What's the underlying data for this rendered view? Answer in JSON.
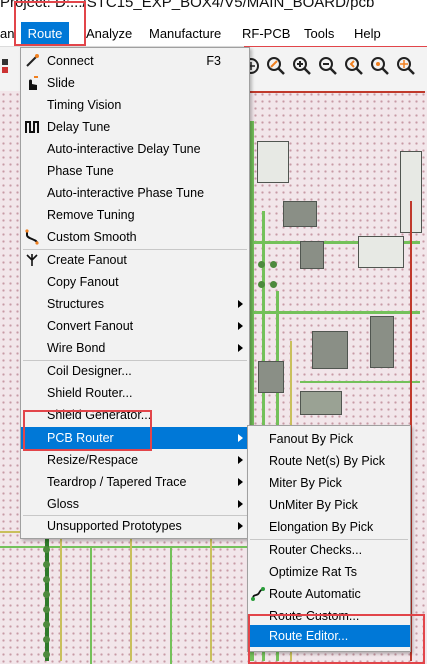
{
  "window": {
    "title": "Project: D:.../STC15_EXP_BOX4/V5/MAIN_BOARD/pcb"
  },
  "menubar": {
    "items": [
      "an",
      "Route",
      "Analyze",
      "Manufacture",
      "RF-PCB",
      "Tools",
      "Help"
    ]
  },
  "route_menu": {
    "items": [
      {
        "label": "Connect",
        "shortcut": "F3",
        "icon": "connect-icon"
      },
      {
        "label": "Slide",
        "icon": "slide-hand-icon"
      },
      {
        "label": "Timing Vision"
      },
      {
        "label": "Delay Tune",
        "icon": "delay-tune-icon"
      },
      {
        "label": "Auto-interactive Delay Tune"
      },
      {
        "label": "Phase Tune"
      },
      {
        "label": "Auto-interactive Phase Tune"
      },
      {
        "label": "Remove Tuning"
      },
      {
        "label": "Custom Smooth",
        "icon": "custom-smooth-icon"
      },
      {
        "label": "Create Fanout",
        "icon": "create-fanout-icon"
      },
      {
        "label": "Copy Fanout"
      },
      {
        "label": "Structures",
        "submenu": true
      },
      {
        "label": "Convert Fanout",
        "submenu": true
      },
      {
        "label": "Wire Bond",
        "submenu": true
      },
      {
        "label": "Coil Designer..."
      },
      {
        "label": "Shield Router..."
      },
      {
        "label": "Shield Generator..."
      },
      {
        "label": "PCB Router",
        "submenu": true,
        "selected": true
      },
      {
        "label": "Resize/Respace",
        "submenu": true
      },
      {
        "label": "Teardrop / Tapered Trace",
        "submenu": true
      },
      {
        "label": "Gloss",
        "submenu": true
      },
      {
        "label": "Unsupported Prototypes",
        "submenu": true
      }
    ]
  },
  "pcb_router_submenu": {
    "items": [
      {
        "label": "Fanout By Pick"
      },
      {
        "label": "Route Net(s) By Pick"
      },
      {
        "label": "Miter By Pick"
      },
      {
        "label": "UnMiter By Pick"
      },
      {
        "label": "Elongation By Pick"
      },
      {
        "label": "Router Checks..."
      },
      {
        "label": "Optimize Rat Ts"
      },
      {
        "label": "Route Automatic",
        "icon": "route-automatic-icon"
      },
      {
        "label": "Route Custom..."
      },
      {
        "label": "Route Editor...",
        "selected": true
      }
    ]
  },
  "colors": {
    "accent": "#0078d7",
    "highlight": "#e2454a",
    "menu_bg": "#f2f2f2",
    "canvas_bg": "#f2e6ea",
    "trace_green": "#74c15a"
  }
}
